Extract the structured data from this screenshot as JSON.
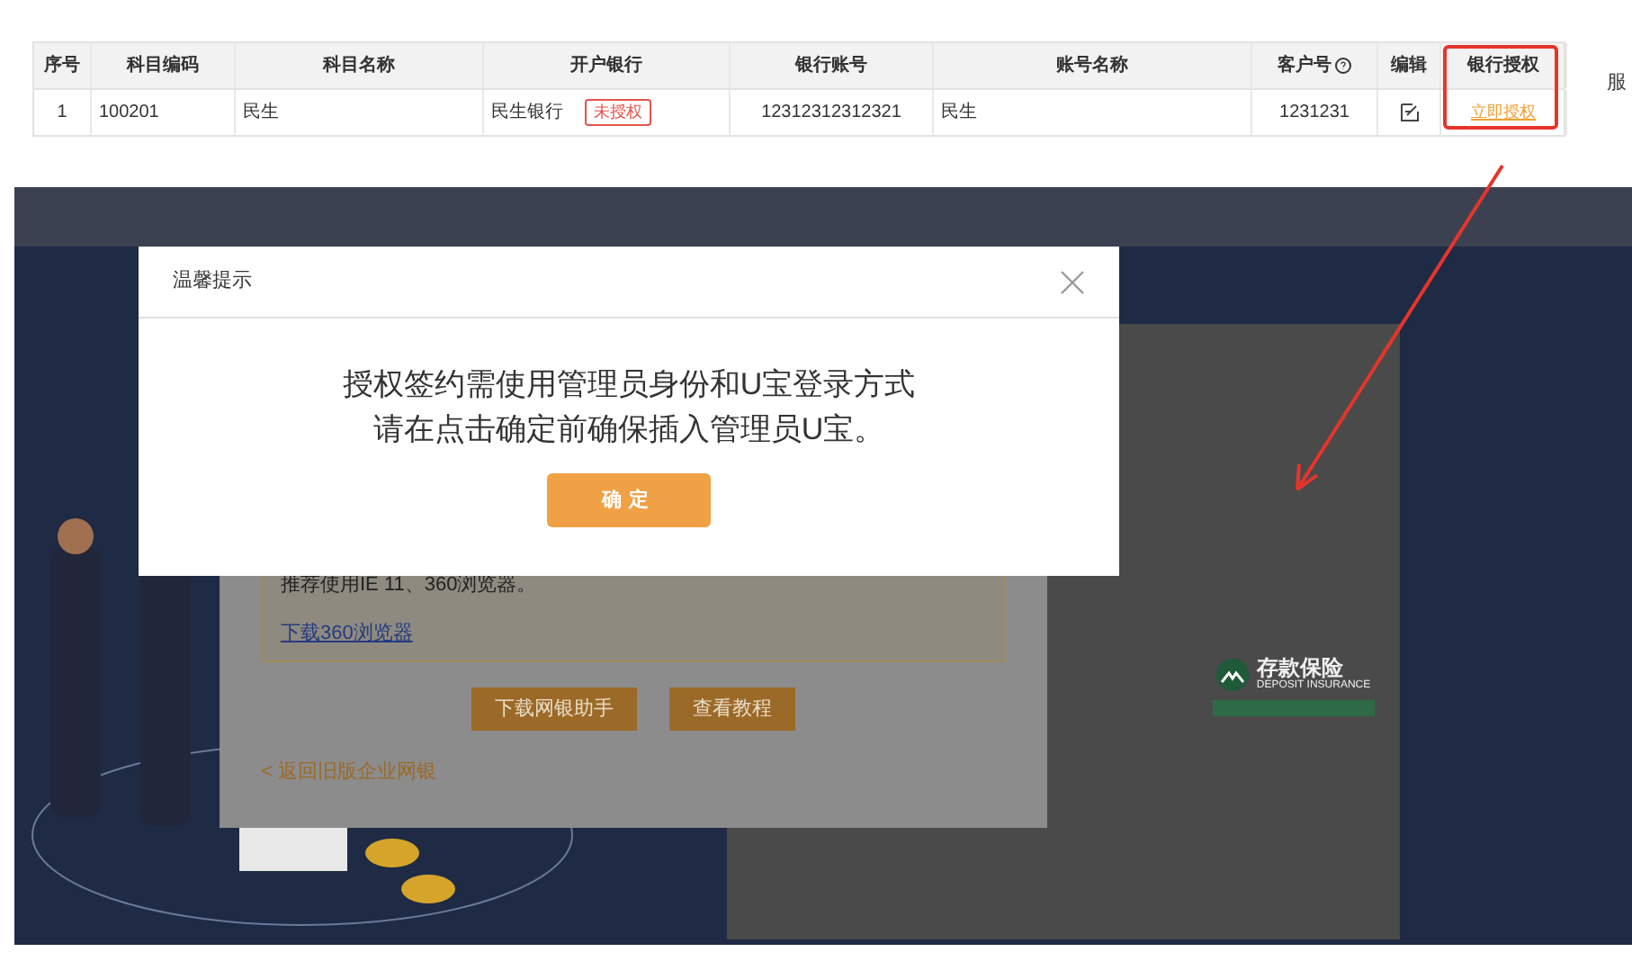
{
  "table": {
    "columns": [
      {
        "label": "序号",
        "kind": "text"
      },
      {
        "label": "科目编码",
        "kind": "text"
      },
      {
        "label": "科目名称",
        "kind": "text"
      },
      {
        "label": "开户银行",
        "kind": "text"
      },
      {
        "label": "银行账号",
        "kind": "text"
      },
      {
        "label": "账号名称",
        "kind": "text"
      },
      {
        "label": "客户号",
        "kind": "help"
      },
      {
        "label": "编辑",
        "kind": "text"
      },
      {
        "label": "银行授权",
        "kind": "text"
      }
    ],
    "rows": [
      {
        "index": "1",
        "code": "100201",
        "subject_name": "民生",
        "bank": "民生银行",
        "auth_status": "未授权",
        "account_no": "12312312312321",
        "account_name": "民生",
        "customer_no": "1231231",
        "action": "立即授权"
      }
    ]
  },
  "side_text": "服",
  "bank_page": {
    "notice": "推荐使用IE 11、360浏览器。",
    "download_link": "下载360浏览器",
    "buttons": [
      "下载网银助手",
      "查看教程"
    ],
    "back_link": "< 返回旧版企业网银",
    "logo_title": "存款保险",
    "logo_subtitle": "DEPOSIT INSURANCE"
  },
  "dialog": {
    "title": "温馨提示",
    "message_lines": [
      "授权签约需使用管理员身份和U宝登录方式",
      "请在点击确定前确保插入管理员U宝。"
    ],
    "button": "确定"
  }
}
